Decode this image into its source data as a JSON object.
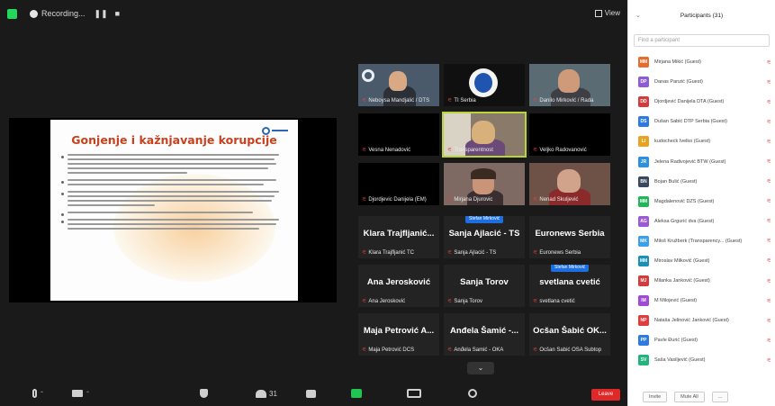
{
  "top": {
    "recording_label": "Recording...",
    "pause_glyph": "❚❚",
    "stop_glyph": "■",
    "view_label": "View"
  },
  "slide": {
    "title": "Gonjenje i kažnjavanje korupcije"
  },
  "tiles_video": [
    {
      "label": "Neboysa Mandjalić / DTS"
    },
    {
      "label": "TI Serbia"
    },
    {
      "label": "Danilo Mirković / Rada"
    },
    {
      "label": "Vesna Nenadović"
    },
    {
      "label": "Transparentnost"
    },
    {
      "label": "Veljko Radovanović"
    },
    {
      "label": "Djordjevic Danijela (EM)"
    },
    {
      "label": "Mirjana Djurovic"
    },
    {
      "label": "Nenad Škuljević"
    }
  ],
  "tiles_name": [
    {
      "big": "Klara Trajfljanić...",
      "label": "Klara Trajfljanić TC",
      "raised": ""
    },
    {
      "big": "Sanja Ajlacić - TS",
      "label": "Sanja Ajlacić - TS",
      "raised": "Stefan Mirković"
    },
    {
      "big": "Euronews Serbia",
      "label": "Euronews Serbia",
      "raised": ""
    },
    {
      "big": "Ana Jerosković",
      "label": "Ana Jerosković",
      "raised": ""
    },
    {
      "big": "Sanja Torov",
      "label": "Sanja Torov",
      "raised": ""
    },
    {
      "big": "svetlana cvetić",
      "label": "svetlana cvetić",
      "raised": "Stefan Mirković"
    },
    {
      "big": "Maja Petrović A...",
      "label": "Maja Petrović DCS",
      "raised": ""
    },
    {
      "big": "Anđela Šamić -...",
      "label": "Anđela Šamić - OKA",
      "raised": ""
    },
    {
      "big": "Ocšan Šabić OK...",
      "label": "Ocšan Šabić OSA Subtop",
      "raised": ""
    }
  ],
  "more_label": "⌄",
  "toolbar": {
    "mute_caret": "⌃",
    "video_caret": "⌃",
    "participants_count": "31",
    "end_label": "Leave"
  },
  "panel": {
    "title": "Participants (31)",
    "chevron": "⌄",
    "search_placeholder": "Find a participant",
    "participants": [
      {
        "initials": "MM",
        "name": "Mirjana Mikić (Guest)",
        "color": "#e36e2f"
      },
      {
        "initials": "DP",
        "name": "Danas Panzić (Guest)",
        "color": "#8d5bd6"
      },
      {
        "initials": "DD",
        "name": "Djordjević Danijela DTA (Guest)",
        "color": "#d43c3c"
      },
      {
        "initials": "DS",
        "name": "Dušan Šabić DTP Serbia (Guest)",
        "color": "#2d7be0"
      },
      {
        "initials": "LI",
        "name": "kudocheck Ivelko (Guest)",
        "color": "#e8a323"
      },
      {
        "initials": "JR",
        "name": "Jelena Radivojević BTW (Guest)",
        "color": "#2d8fe0"
      },
      {
        "initials": "BN",
        "name": "Bojan Bulić (Guest)",
        "color": "#3a4a5c"
      },
      {
        "initials": "MM",
        "name": "Magdalenović DZS (Guest)",
        "color": "#23b45c"
      },
      {
        "initials": "AG",
        "name": "Aleksa Grgurić dva (Guest)",
        "color": "#9b59d6"
      },
      {
        "initials": "MK",
        "name": "Miloš Kružberk (Transparency... (Guest)",
        "color": "#3aa0e8"
      },
      {
        "initials": "MM",
        "name": "Miroslav Milković (Guest)",
        "color": "#1b8fb5"
      },
      {
        "initials": "MJ",
        "name": "Milanka Janković (Guest)",
        "color": "#d43c3c"
      },
      {
        "initials": "IM",
        "name": "M Milojević (Guest)",
        "color": "#a04bd6"
      },
      {
        "initials": "NP",
        "name": "Nataša Jelinović Janković (Guest)",
        "color": "#e23b3b"
      },
      {
        "initials": "PP",
        "name": "Pavle Đurić (Guest)",
        "color": "#2d7be0"
      },
      {
        "initials": "SV",
        "name": "Saša Vasiljević (Guest)",
        "color": "#23b47e"
      }
    ],
    "mic_glyph": "⚟",
    "invite_label": "Invite",
    "mute_all_label": "Mute All",
    "more_label": "..."
  }
}
